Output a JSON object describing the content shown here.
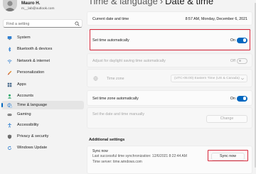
{
  "user": {
    "name": "Mauro H.",
    "email": "m__lab@outlook.com"
  },
  "search": {
    "placeholder": "Find a setting"
  },
  "sidebar": {
    "items": [
      {
        "label": "System",
        "icon": "monitor-icon"
      },
      {
        "label": "Bluetooth & devices",
        "icon": "bluetooth-icon"
      },
      {
        "label": "Network & internet",
        "icon": "wifi-icon"
      },
      {
        "label": "Personalization",
        "icon": "brush-icon"
      },
      {
        "label": "Apps",
        "icon": "apps-icon"
      },
      {
        "label": "Accounts",
        "icon": "person-icon"
      },
      {
        "label": "Time & language",
        "icon": "globe-clock-icon",
        "active": true
      },
      {
        "label": "Gaming",
        "icon": "gamepad-icon"
      },
      {
        "label": "Accessibility",
        "icon": "accessibility-icon"
      },
      {
        "label": "Privacy & security",
        "icon": "shield-icon"
      },
      {
        "label": "Windows Update",
        "icon": "update-icon"
      }
    ]
  },
  "header": {
    "crumb": "Time & language",
    "separator": "›",
    "title": "Date & time"
  },
  "settings": {
    "current": {
      "label": "Current date and time",
      "value": "8:57 AM, Monday, December 6, 2021"
    },
    "set_time_auto": {
      "label": "Set time automatically",
      "state": "On"
    },
    "daylight": {
      "label": "Adjust for daylight saving time automatically",
      "state": "Off"
    },
    "timezone": {
      "label": "Time zone",
      "value": "(UTC-05:00) Eastern Time (US & Canada)"
    },
    "set_tz_auto": {
      "label": "Set time zone automatically",
      "state": "On"
    },
    "manual": {
      "label": "Set the date and time manually",
      "button": "Change"
    }
  },
  "additional": {
    "title": "Additional settings",
    "sync_title": "Sync now",
    "sync_last": "Last successful time synchronization: 12/6/2021 8:22:44 AM",
    "sync_server": "Time server: time.windows.com",
    "sync_button": "Sync now"
  },
  "colors": {
    "accent": "#0067c0",
    "highlight": "#d7273a",
    "background": "#f3f3f3",
    "card": "#fbfbfb"
  }
}
